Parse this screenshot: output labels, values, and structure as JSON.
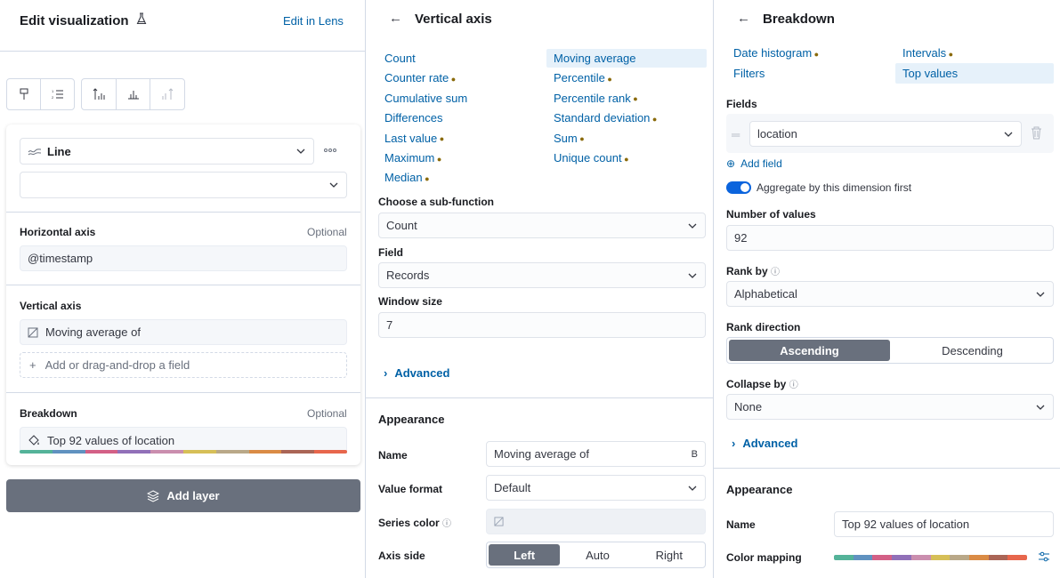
{
  "colors": [
    "#54b399",
    "#6092c0",
    "#d36086",
    "#9170b8",
    "#ca8eae",
    "#d6bf57",
    "#b9a888",
    "#da8b45",
    "#aa6556",
    "#e7664c"
  ],
  "left": {
    "title": "Edit visualization",
    "edit_in_lens": "Edit in Lens",
    "chart_type": "Line",
    "horizontal_axis": {
      "label": "Horizontal axis",
      "optional": "Optional",
      "value": "@timestamp"
    },
    "vertical_axis": {
      "label": "Vertical axis",
      "value": "Moving average of",
      "add": "Add or drag-and-drop a field"
    },
    "breakdown": {
      "label": "Breakdown",
      "optional": "Optional",
      "value": "Top 92 values of location"
    },
    "add_layer": "Add layer"
  },
  "middle": {
    "title": "Vertical axis",
    "functions_left": [
      {
        "label": "Count",
        "dot": false
      },
      {
        "label": "Counter rate",
        "dot": true
      },
      {
        "label": "Cumulative sum",
        "dot": false
      },
      {
        "label": "Differences",
        "dot": false
      },
      {
        "label": "Last value",
        "dot": true
      },
      {
        "label": "Maximum",
        "dot": true
      },
      {
        "label": "Median",
        "dot": true
      }
    ],
    "functions_right": [
      {
        "label": "Moving average",
        "dot": false
      },
      {
        "label": "Percentile",
        "dot": true
      },
      {
        "label": "Percentile rank",
        "dot": true
      },
      {
        "label": "Standard deviation",
        "dot": true
      },
      {
        "label": "Sum",
        "dot": true
      },
      {
        "label": "Unique count",
        "dot": true
      }
    ],
    "sub_function_label": "Choose a sub-function",
    "sub_function_value": "Count",
    "field_label": "Field",
    "field_value": "Records",
    "window_label": "Window size",
    "window_value": "7",
    "advanced": "Advanced",
    "appearance": "Appearance",
    "name_label": "Name",
    "name_value": "Moving average of",
    "value_format_label": "Value format",
    "value_format_value": "Default",
    "series_color_label": "Series color",
    "axis_side_label": "Axis side",
    "axis_side_options": [
      "Left",
      "Auto",
      "Right"
    ]
  },
  "right": {
    "title": "Breakdown",
    "functions": [
      "Date histogram",
      "Intervals",
      "Filters",
      "Top values"
    ],
    "fields_label": "Fields",
    "field_value": "location",
    "add_field": "Add field",
    "aggregate_label": "Aggregate by this dimension first",
    "number_label": "Number of values",
    "number_value": "92",
    "rank_by_label": "Rank by",
    "rank_by_value": "Alphabetical",
    "rank_direction_label": "Rank direction",
    "rank_direction_options": [
      "Ascending",
      "Descending"
    ],
    "collapse_label": "Collapse by",
    "collapse_value": "None",
    "advanced": "Advanced",
    "appearance": "Appearance",
    "name_label": "Name",
    "name_value": "Top 92 values of location",
    "color_mapping_label": "Color mapping"
  }
}
